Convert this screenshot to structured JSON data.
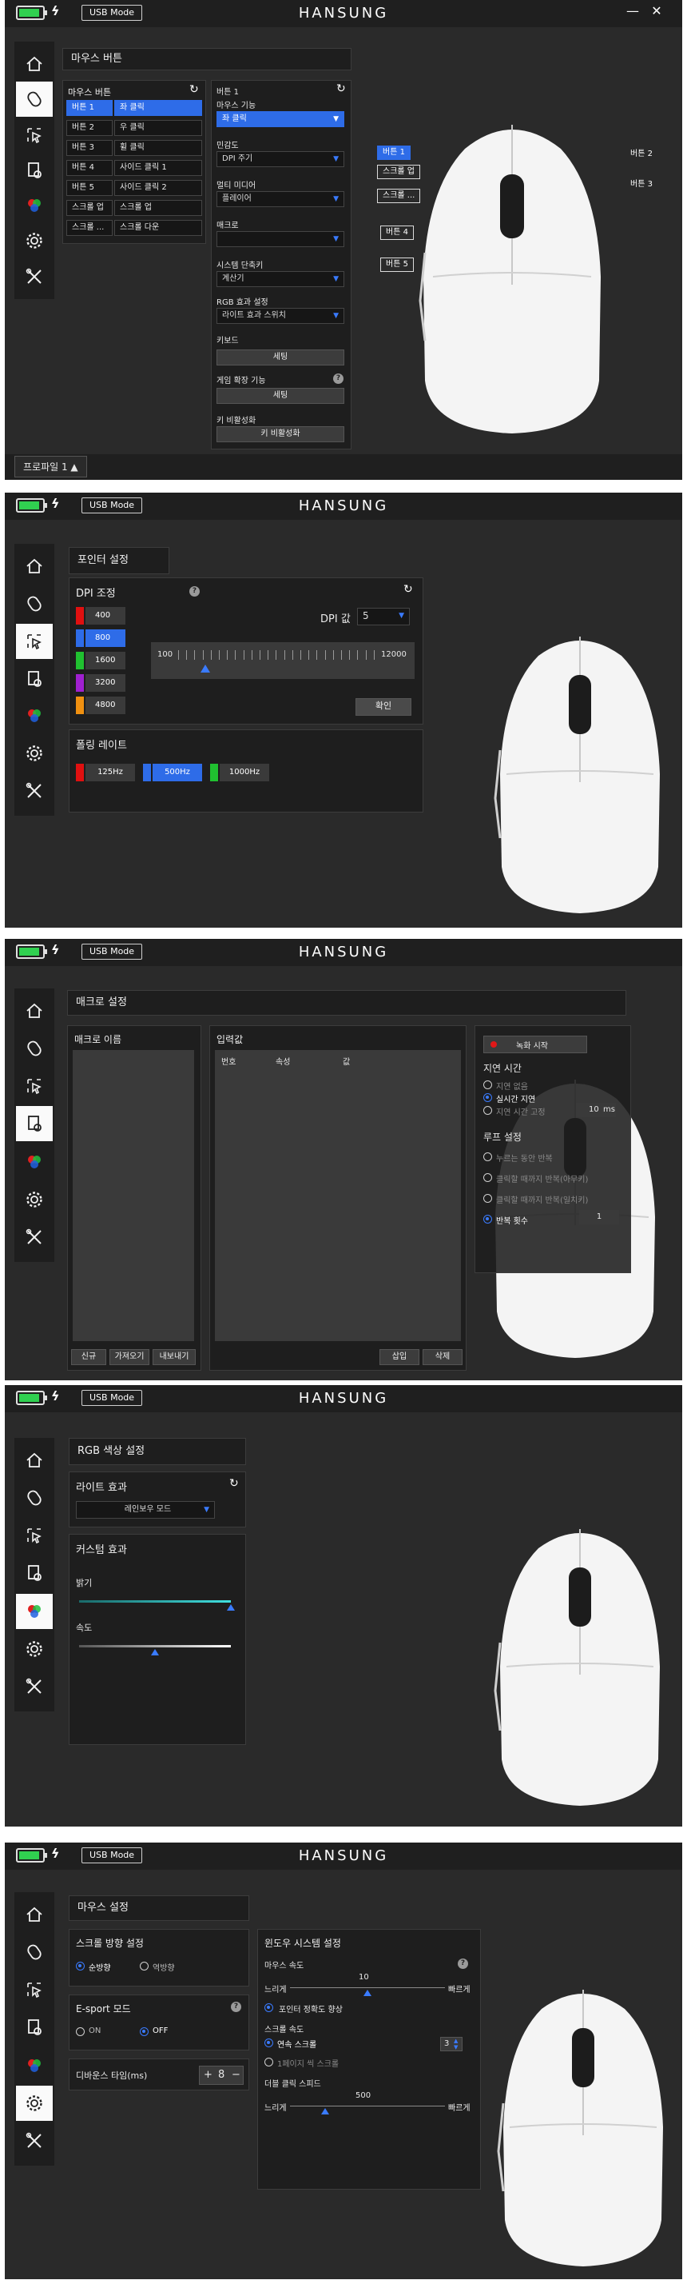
{
  "app": {
    "brand": "HANSUNG",
    "usb_mode": "USB Mode",
    "battery_percent": 85,
    "battery_color": "#30d050",
    "accent": "#2e6ce8",
    "minimize_icon": "minimize-icon",
    "close_icon": "close-icon"
  },
  "sidebar_icons": [
    "home-icon",
    "mouse-button-icon",
    "pointer-icon",
    "macro-icon",
    "rgb-icon",
    "settings-icon",
    "tools-icon"
  ],
  "s1": {
    "title": "마우스 버튼",
    "list_title": "마우스 버튼",
    "rows": [
      {
        "btn": "버튼 1",
        "func": "좌 클릭"
      },
      {
        "btn": "버튼 2",
        "func": "우 클릭"
      },
      {
        "btn": "버튼 3",
        "func": "휠 클릭"
      },
      {
        "btn": "버튼 4",
        "func": "사이드 클릭 1"
      },
      {
        "btn": "버튼 5",
        "func": "사이드 클릭 2"
      },
      {
        "btn": "스크롤 업",
        "func": "스크롤 업"
      },
      {
        "btn": "스크롤 ...",
        "func": "스크롤 다운"
      }
    ],
    "cfg_title": "버튼 1",
    "mouse_func_label": "마우스 기능",
    "mouse_func_value": "좌 클릭",
    "sens_label": "민감도",
    "sens_value": "DPI 주기",
    "multimedia_label": "멀티 미디어",
    "multimedia_value": "플레이어",
    "macro_label": "매크로",
    "macro_value": "",
    "shortcut_label": "시스템 단축키",
    "shortcut_value": "계산기",
    "rgb_label": "RGB 효과 설정",
    "rgb_value": "라이트 효과 스위치",
    "keyboard_label": "키보드",
    "keyboard_btn": "세팅",
    "game_label": "게임 확장 기능",
    "game_btn": "세팅",
    "disable_label": "키 비활성화",
    "disable_btn": "키 비활성화",
    "callouts_left": [
      "버튼 1",
      "스크롤 업",
      "스크롤 ...",
      "버튼 4",
      "버튼 5"
    ],
    "callouts_right": [
      "버튼 2",
      "버튼 3"
    ],
    "profile": "프로파일 1 ▲"
  },
  "s2": {
    "title": "포인터 설정",
    "dpi_title": "DPI 조정",
    "dpi_levels": [
      {
        "value": "400",
        "color": "#e01010",
        "selected": false
      },
      {
        "value": "800",
        "color": "#2e6ce8",
        "selected": true
      },
      {
        "value": "1600",
        "color": "#20c030",
        "selected": false
      },
      {
        "value": "3200",
        "color": "#a020d0",
        "selected": false
      },
      {
        "value": "4800",
        "color": "#f09010",
        "selected": false
      }
    ],
    "dpi_value_label": "DPI 값",
    "dpi_count": "5",
    "slider_min": "100",
    "slider_max": "12000",
    "slider_value": 800,
    "confirm": "확인",
    "polling_title": "폴링 레이트",
    "polling": [
      {
        "value": "125Hz",
        "color": "#e01010",
        "selected": false
      },
      {
        "value": "500Hz",
        "color": "#2e6ce8",
        "selected": true
      },
      {
        "value": "1000Hz",
        "color": "#20c030",
        "selected": false
      }
    ]
  },
  "s3": {
    "title": "매크로 설정",
    "name_title": "매크로 이름",
    "input_title": "입력값",
    "col_num": "번호",
    "col_attr": "속성",
    "col_val": "값",
    "btn_new": "신규",
    "btn_import": "가져오기",
    "btn_export": "내보내기",
    "btn_insert": "삽입",
    "btn_delete": "삭제",
    "record": "녹화 시작",
    "delay_title": "지연 시간",
    "delay_opts": [
      "지연 없음",
      "실시간 지연",
      "지연 시간 고정"
    ],
    "delay_selected": 1,
    "fixed_value": "10",
    "fixed_unit": "ms",
    "loop_title": "루프 설정",
    "loop_opts": [
      "누르는 동안 반복",
      "클릭할 때까지 반복(아무키)",
      "클릭할 때까지 반복(일치키)",
      "반복 횟수"
    ],
    "loop_selected": 3,
    "repeat_count": "1"
  },
  "s4": {
    "title": "RGB 색상 설정",
    "light_title": "라이트 효과",
    "light_value": "레인보우 모드",
    "custom_title": "커스텀 효과",
    "brightness_label": "밝기",
    "brightness": 100,
    "speed_label": "속도",
    "speed": 50
  },
  "s5": {
    "title": "마우스 설정",
    "scroll_dir_title": "스크롤 방향 설정",
    "scroll_dir_opts": [
      "순방향",
      "역방향"
    ],
    "scroll_dir_selected": 0,
    "esport_title": "E-sport 모드",
    "esport_opts": [
      "ON",
      "OFF"
    ],
    "esport_selected": 1,
    "debounce_label": "디바운스 타임(ms)",
    "debounce_value": "8",
    "plus": "+",
    "minus": "−",
    "win_title": "윈도우 시스템 설정",
    "speed_label": "마우스 속도",
    "speed_value": "10",
    "slow": "느리게",
    "fast": "빠르게",
    "speed_level": 10,
    "precision_label": "포인터 정확도 향상",
    "scroll_speed_label": "스크롤 속도",
    "scroll_opts": [
      "연속 스크롤",
      "1페이지 씩 스크롤"
    ],
    "scroll_selected": 0,
    "scroll_lines": "3",
    "dbl_label": "더블 클릭 스피드",
    "dbl_value": "500",
    "dbl_level": 500
  }
}
